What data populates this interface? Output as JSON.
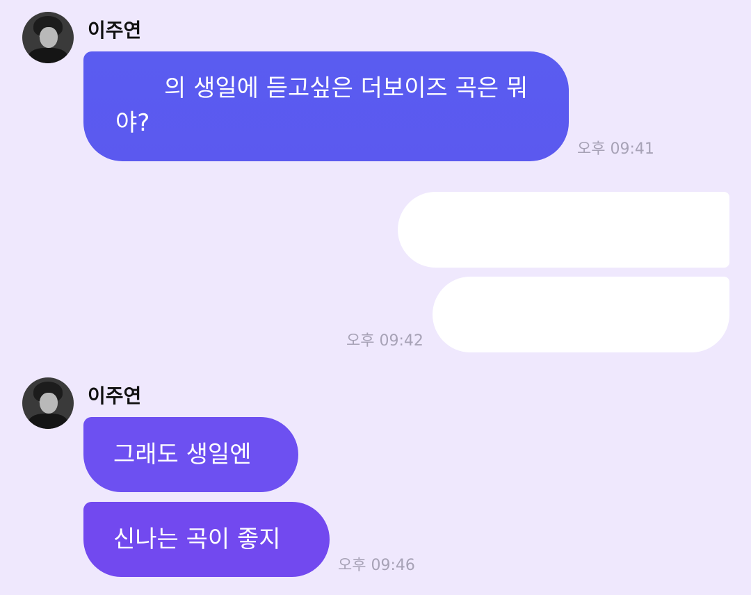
{
  "colors": {
    "background": "#efe8fd",
    "bubble_1": "#5a5cf0",
    "bubble_2": "#6d50f1",
    "bubble_3": "#7249ef",
    "outgoing_bubble": "#ffffff",
    "timestamp": "#a7a2b6"
  },
  "messages": {
    "group1": {
      "sender": "이주연",
      "avatar_icon": "profile-photo",
      "bubble_text": "의 생일에 듣고싶은 더보이즈 곡은 뭐야?",
      "time": "오후 09:41"
    },
    "outgoing": {
      "bubble1_text": "",
      "bubble2_text": "",
      "time": "오후 09:42"
    },
    "group2": {
      "sender": "이주연",
      "avatar_icon": "profile-photo",
      "bubble1_text": "그래도 생일엔",
      "bubble2_text": "신나는 곡이 좋지",
      "time": "오후 09:46"
    }
  }
}
